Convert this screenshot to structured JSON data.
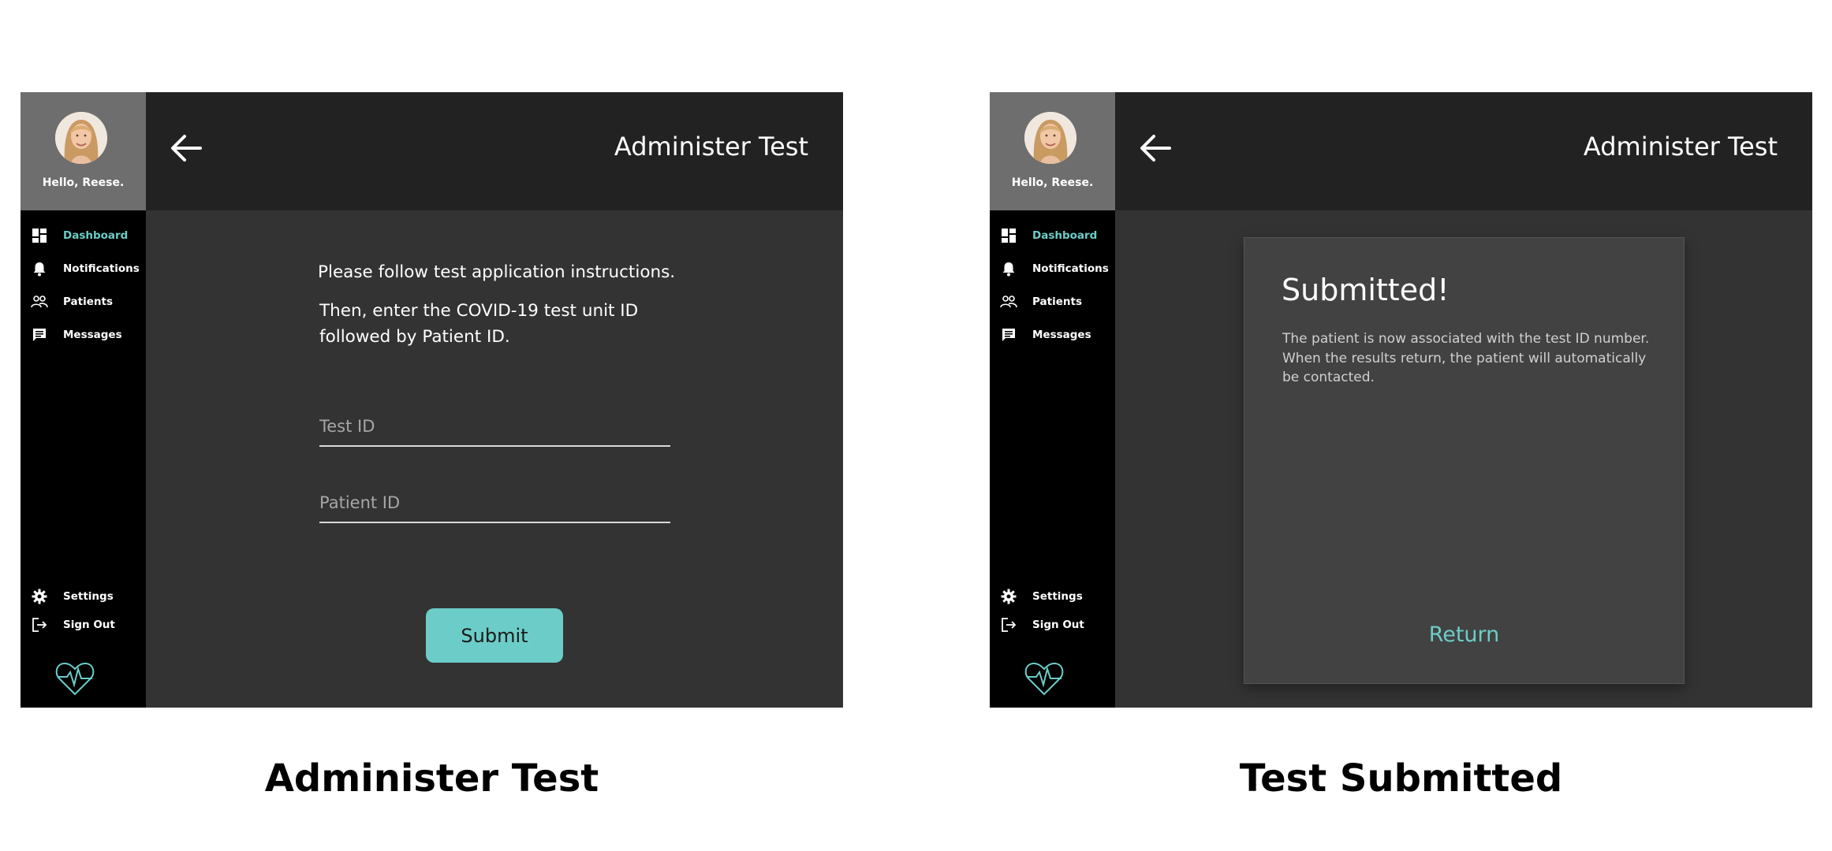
{
  "screens": [
    {
      "sidebar": {
        "greeting": "Hello, Reese.",
        "nav": [
          "Dashboard",
          "Notifications",
          "Patients",
          "Messages"
        ],
        "bottom": [
          "Settings",
          "Sign Out"
        ]
      },
      "header": {
        "title": "Administer Test"
      },
      "form": {
        "instruction_1": "Please follow test application instructions.",
        "instruction_2": "Then, enter the COVID-19 test unit ID followed by Patient ID.",
        "test_id_placeholder": "Test ID",
        "patient_id_placeholder": "Patient ID",
        "submit_label": "Submit"
      }
    },
    {
      "sidebar": {
        "greeting": "Hello, Reese.",
        "nav": [
          "Dashboard",
          "Notifications",
          "Patients",
          "Messages"
        ],
        "bottom": [
          "Settings",
          "Sign Out"
        ]
      },
      "header": {
        "title": "Administer Test"
      },
      "dialog": {
        "title": "Submitted!",
        "body": "The patient is now associated with the test ID number. When the results return, the patient will automatically be contacted.",
        "return_label": "Return"
      }
    }
  ],
  "captions": [
    "Administer Test",
    "Test Submitted"
  ],
  "theme": {
    "accent": "#6ccdc8",
    "sidebar_bg": "#000000",
    "header_bg": "#222222",
    "content_bg": "#333333",
    "profile_bg": "#6e6e6e",
    "card_bg": "#424242"
  },
  "icons": {
    "nav": [
      "dashboard-icon",
      "bell-icon",
      "people-icon",
      "message-icon"
    ],
    "bottom": [
      "gear-icon",
      "sign-out-icon"
    ],
    "back": "arrow-left-icon",
    "logo": "heart-pulse-logo"
  },
  "active_nav": "Dashboard"
}
